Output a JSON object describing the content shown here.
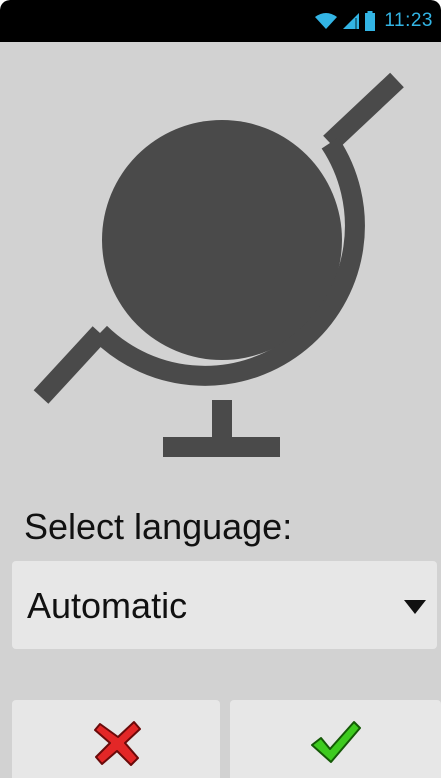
{
  "status_bar": {
    "time": "11:23",
    "icons": [
      "wifi-icon",
      "signal-icon",
      "battery-icon"
    ],
    "time_color": "#33b5e5"
  },
  "illustration": {
    "icon": "globe-icon",
    "color": "#4a4a4a"
  },
  "language": {
    "label": "Select language:",
    "selected": "Automatic",
    "arrow_icon": "dropdown-arrow-icon"
  },
  "buttons": {
    "cancel_icon": "red-x-icon",
    "confirm_icon": "green-check-icon",
    "cancel_color": "#e32727",
    "confirm_color": "#3ecb1f"
  }
}
